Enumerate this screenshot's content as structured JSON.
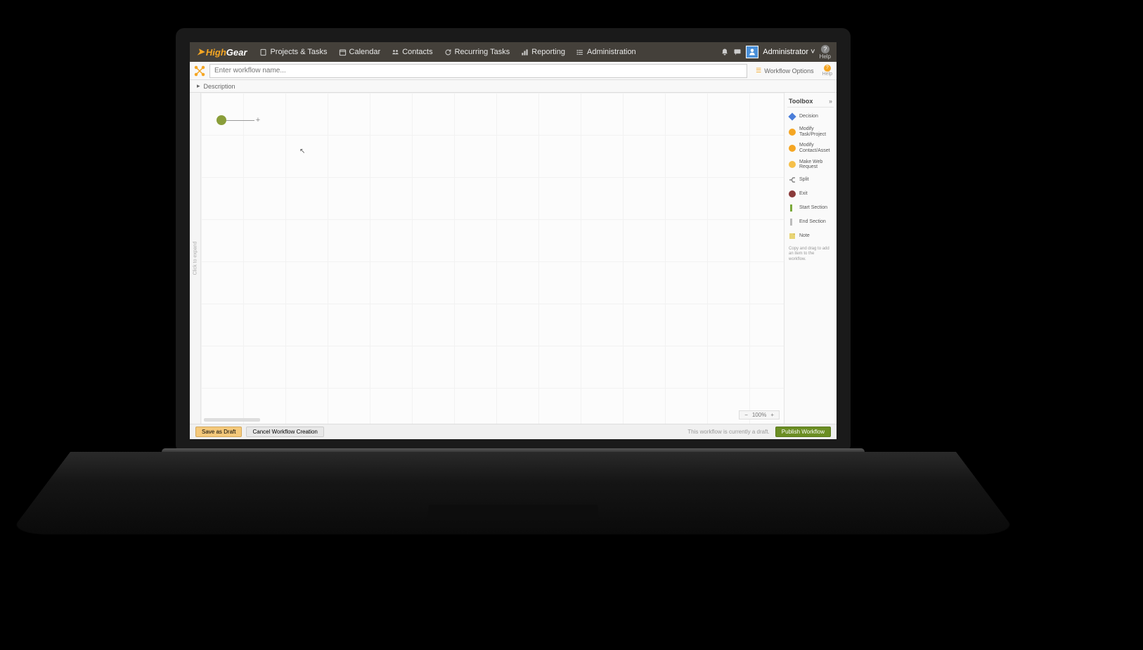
{
  "logo": {
    "part1": "High",
    "part2": "Gear"
  },
  "nav": [
    {
      "label": "Projects & Tasks"
    },
    {
      "label": "Calendar"
    },
    {
      "label": "Contacts"
    },
    {
      "label": "Recurring Tasks"
    },
    {
      "label": "Reporting"
    },
    {
      "label": "Administration"
    }
  ],
  "user": {
    "label": "Administrator"
  },
  "help": {
    "label": "Help"
  },
  "workflow": {
    "name_placeholder": "Enter workflow name...",
    "options_label": "Workflow Options",
    "description_label": "Description"
  },
  "canvas": {
    "sidebar_text": "Click to expand",
    "zoom": "100%"
  },
  "toolbox": {
    "title": "Toolbox",
    "items": [
      {
        "label": "Decision",
        "color": "#4a7dd9",
        "shape": "diamond"
      },
      {
        "label": "Modify Task/Project",
        "color": "#f5a623",
        "shape": "circle"
      },
      {
        "label": "Modify Contact/Asset",
        "color": "#f5a623",
        "shape": "circle"
      },
      {
        "label": "Make Web Request",
        "color": "#f5c04a",
        "shape": "circle"
      },
      {
        "label": "Split",
        "color": "#888",
        "shape": "split"
      },
      {
        "label": "Exit",
        "color": "#8a3a3a",
        "shape": "circle"
      },
      {
        "label": "Start Section",
        "color": "#7aa83a",
        "shape": "bracket"
      },
      {
        "label": "End Section",
        "color": "#bbb",
        "shape": "bracket"
      },
      {
        "label": "Note",
        "color": "#e8d475",
        "shape": "note"
      }
    ],
    "hint": "Copy and drag to add an item to the workflow."
  },
  "footer": {
    "save": "Save as Draft",
    "cancel": "Cancel Workflow Creation",
    "draft_msg": "This workflow is currently a draft.",
    "publish": "Publish Workflow"
  }
}
